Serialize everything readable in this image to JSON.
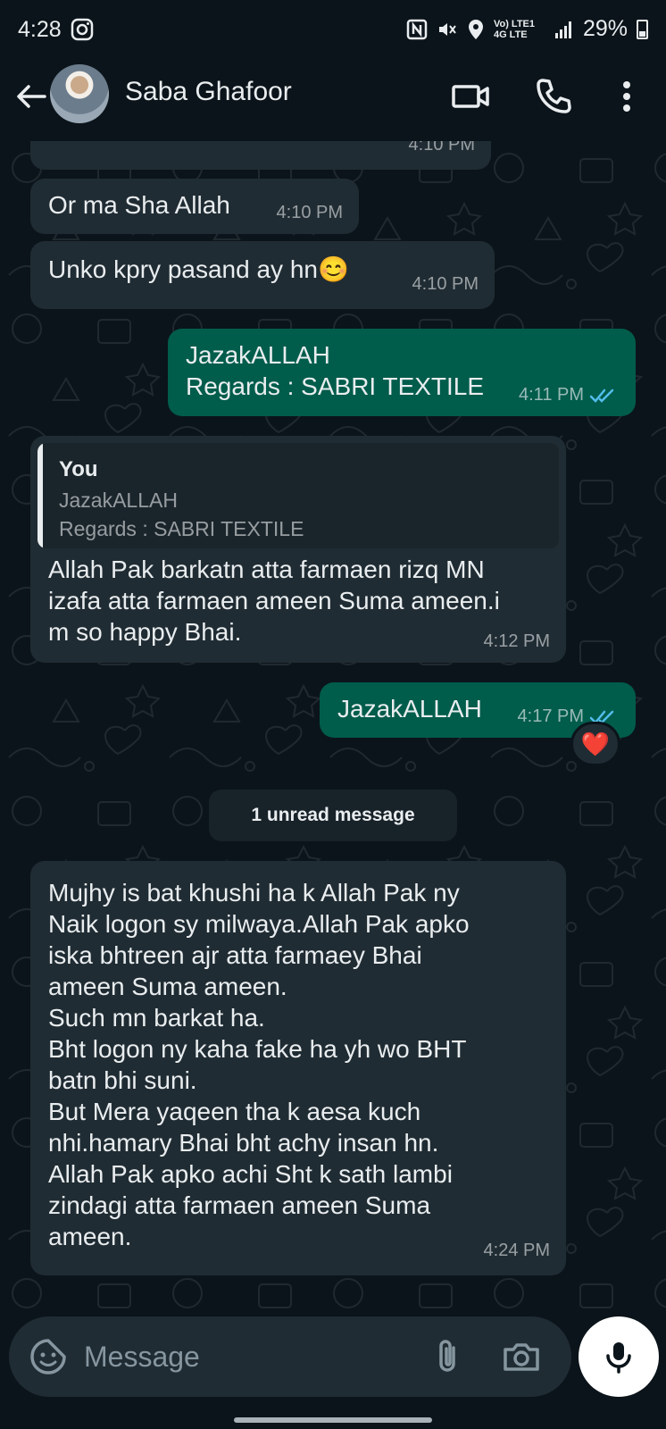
{
  "status_bar": {
    "time": "4:28",
    "network": "Vo) LTE1 4G LTE",
    "battery": "29%"
  },
  "header": {
    "contact_name": "Saba Ghafoor"
  },
  "messages": [
    {
      "direction": "incoming",
      "text": "",
      "time": "4:10 PM"
    },
    {
      "direction": "incoming",
      "text": "Or ma Sha Allah",
      "time": "4:10 PM"
    },
    {
      "direction": "incoming",
      "text": "Unko kpry pasand ay hn😊",
      "time": "4:10 PM"
    },
    {
      "direction": "outgoing",
      "text": "JazakALLAH\nRegards : SABRI TEXTILE",
      "time": "4:11 PM",
      "status": "read"
    },
    {
      "direction": "incoming",
      "quote": {
        "author": "You",
        "text": "JazakALLAH\nRegards : SABRI TEXTILE"
      },
      "text": "Allah Pak barkatn atta farmaen rizq MN\nizafa atta farmaen ameen Suma ameen.i\nm so happy Bhai.",
      "time": "4:12 PM"
    },
    {
      "direction": "outgoing",
      "text": "JazakALLAH",
      "time": "4:17 PM",
      "status": "read",
      "reaction": "❤️"
    },
    {
      "direction": "incoming",
      "text": "Mujhy is bat khushi ha k Allah Pak ny\nNaik logon sy milwaya.Allah Pak apko\niska bhtreen ajr atta farmaey Bhai\nameen Suma ameen.\nSuch mn barkat ha.\nBht logon ny kaha fake ha yh wo BHT\nbatn bhi suni.\nBut Mera yaqeen tha k aesa kuch\nnhi.hamary Bhai bht achy insan hn.\nAllah Pak apko achi Sht k sath lambi\nzindagi atta farmaen ameen Suma\nameen.",
      "time": "4:24 PM"
    }
  ],
  "unread_divider": "1 unread message",
  "composer": {
    "placeholder": "Message"
  },
  "colors": {
    "background": "#0b141a",
    "incoming_bubble": "#202c33",
    "outgoing_bubble": "#005c4b",
    "read_ticks": "#53bdeb"
  }
}
